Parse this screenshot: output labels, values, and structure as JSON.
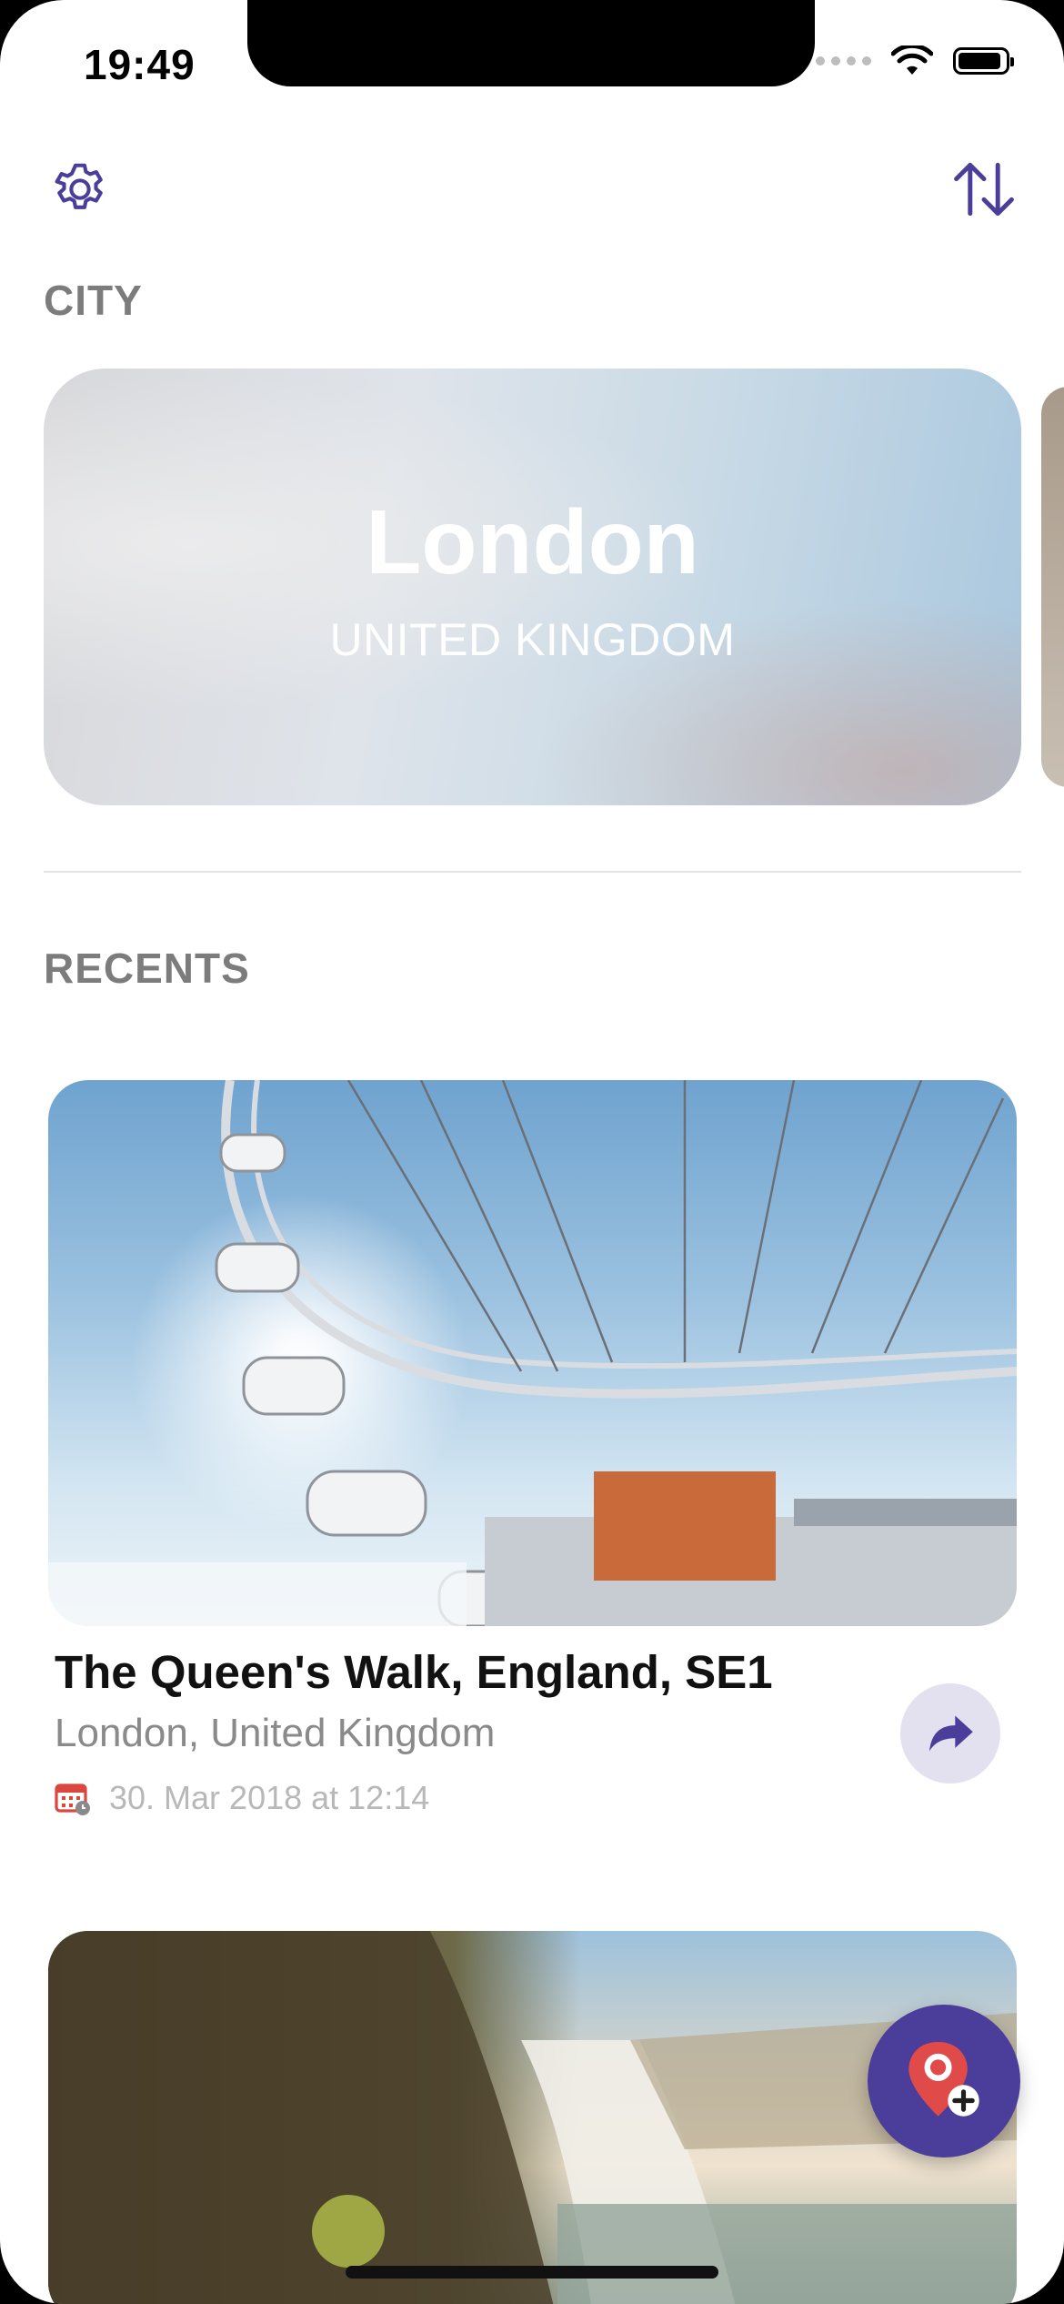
{
  "status_bar": {
    "time": "19:49"
  },
  "sections": {
    "city_label": "CITY",
    "recents_label": "RECENTS"
  },
  "city_card": {
    "name": "London",
    "country": "UNITED KINGDOM"
  },
  "recents": [
    {
      "title": "The Queen's Walk, England, SE1",
      "subtitle": "London, United Kingdom",
      "date": "30. Mar 2018 at 12:14"
    }
  ],
  "colors": {
    "accent": "#4b3d9a",
    "label_gray": "#7c7c7c"
  },
  "icons": {
    "settings": "gear-icon",
    "sort": "sort-arrows-icon",
    "share": "share-arrow-icon",
    "calendar": "calendar-icon",
    "add_location": "add-location-icon"
  }
}
